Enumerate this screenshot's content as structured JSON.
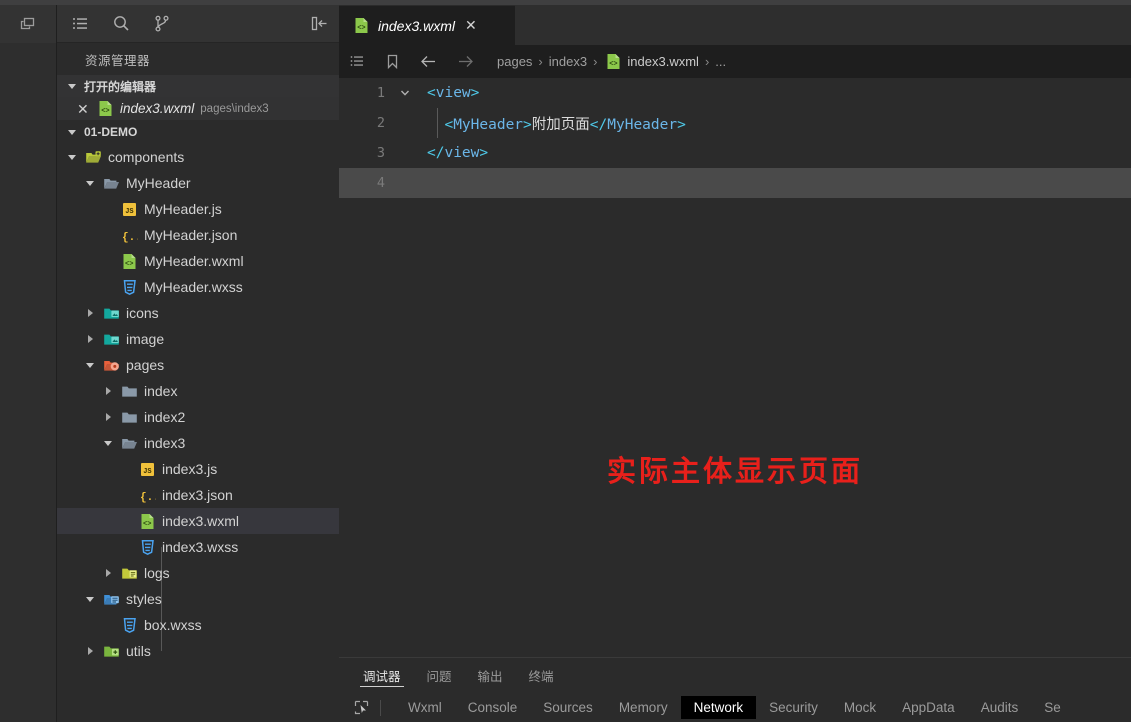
{
  "activitybar": {
    "top_icon": "window-restore-icon",
    "icons": [
      "explorer-list-icon",
      "search-icon",
      "source-control-icon"
    ],
    "collapse_icon": "collapse-sidebar-icon"
  },
  "sidebar": {
    "title": "资源管理器",
    "open_editors": {
      "label": "打开的编辑器",
      "items": [
        {
          "close": "✕",
          "icon": "wxml-file-icon",
          "name": "index3.wxml",
          "path": "pages\\index3"
        }
      ]
    },
    "project": {
      "label": "01-DEMO",
      "tree": [
        {
          "depth": 1,
          "twisty": "down",
          "icon": "folder-components-icon",
          "label": "components",
          "selected": false
        },
        {
          "depth": 2,
          "twisty": "down",
          "icon": "folder-open-icon",
          "label": "MyHeader",
          "selected": false
        },
        {
          "depth": 3,
          "twisty": "blank",
          "icon": "js-file-icon",
          "label": "MyHeader.js",
          "selected": false
        },
        {
          "depth": 3,
          "twisty": "blank",
          "icon": "json-file-icon",
          "label": "MyHeader.json",
          "selected": false
        },
        {
          "depth": 3,
          "twisty": "blank",
          "icon": "wxml-file-icon",
          "label": "MyHeader.wxml",
          "selected": false
        },
        {
          "depth": 3,
          "twisty": "blank",
          "icon": "wxss-file-icon",
          "label": "MyHeader.wxss",
          "selected": false
        },
        {
          "depth": 2,
          "twisty": "right",
          "icon": "folder-icons-icon",
          "label": "icons",
          "selected": false
        },
        {
          "depth": 2,
          "twisty": "right",
          "icon": "folder-image-icon",
          "label": "image",
          "selected": false
        },
        {
          "depth": 2,
          "twisty": "down",
          "icon": "folder-pages-icon",
          "label": "pages",
          "selected": false
        },
        {
          "depth": 3,
          "twisty": "right",
          "icon": "folder-closed-icon",
          "label": "index",
          "selected": false
        },
        {
          "depth": 3,
          "twisty": "right",
          "icon": "folder-closed-icon",
          "label": "index2",
          "selected": false
        },
        {
          "depth": 3,
          "twisty": "down",
          "icon": "folder-open-icon",
          "label": "index3",
          "selected": false
        },
        {
          "depth": 4,
          "twisty": "blank",
          "icon": "js-file-icon",
          "label": "index3.js",
          "selected": false
        },
        {
          "depth": 4,
          "twisty": "blank",
          "icon": "json-file-icon",
          "label": "index3.json",
          "selected": false
        },
        {
          "depth": 4,
          "twisty": "blank",
          "icon": "wxml-file-icon",
          "label": "index3.wxml",
          "selected": true
        },
        {
          "depth": 4,
          "twisty": "blank",
          "icon": "wxss-file-icon",
          "label": "index3.wxss",
          "selected": false
        },
        {
          "depth": 3,
          "twisty": "right",
          "icon": "folder-logs-icon",
          "label": "logs",
          "selected": false
        },
        {
          "depth": 2,
          "twisty": "down",
          "icon": "folder-styles-icon",
          "label": "styles",
          "selected": false
        },
        {
          "depth": 3,
          "twisty": "blank",
          "icon": "wxss-file-icon",
          "label": "box.wxss",
          "selected": false
        },
        {
          "depth": 2,
          "twisty": "right",
          "icon": "folder-utils-icon",
          "label": "utils",
          "selected": false
        }
      ]
    }
  },
  "editor": {
    "tab": {
      "icon": "wxml-file-icon",
      "name": "index3.wxml",
      "close": "✕"
    },
    "breadcrumb": {
      "icons": [
        "outline-list-icon",
        "bookmark-icon",
        "back-arrow-icon",
        "forward-arrow-icon"
      ],
      "items": [
        "pages",
        "index3",
        "index3.wxml",
        "..."
      ],
      "separator": "›",
      "file_icon": "wxml-file-icon"
    },
    "lines": [
      {
        "n": "1",
        "fold": "v",
        "indent_guide": false,
        "active": false,
        "tokens": [
          {
            "t": "<",
            "c": "br"
          },
          {
            "t": "view",
            "c": "tag"
          },
          {
            "t": ">",
            "c": "br"
          }
        ]
      },
      {
        "n": "2",
        "fold": "",
        "indent_guide": true,
        "active": false,
        "tokens": [
          {
            "t": "  <",
            "c": "br"
          },
          {
            "t": "MyHeader",
            "c": "tag"
          },
          {
            "t": ">",
            "c": "br"
          },
          {
            "t": "附加页面",
            "c": "txt"
          },
          {
            "t": "</",
            "c": "br"
          },
          {
            "t": "MyHeader",
            "c": "tag"
          },
          {
            "t": ">",
            "c": "br"
          }
        ]
      },
      {
        "n": "3",
        "fold": "",
        "indent_guide": false,
        "active": false,
        "tokens": [
          {
            "t": "</",
            "c": "br"
          },
          {
            "t": "view",
            "c": "tag"
          },
          {
            "t": ">",
            "c": "br"
          }
        ]
      },
      {
        "n": "4",
        "fold": "",
        "indent_guide": false,
        "active": true,
        "tokens": []
      }
    ],
    "preview_text": "实际主体显示页面"
  },
  "panel": {
    "tabs": [
      {
        "label": "调试器",
        "active": true
      },
      {
        "label": "问题",
        "active": false
      },
      {
        "label": "输出",
        "active": false
      },
      {
        "label": "终端",
        "active": false
      }
    ],
    "inspect_icon": "inspect-element-icon",
    "devtools_tabs": [
      {
        "label": "Wxml",
        "active": false
      },
      {
        "label": "Console",
        "active": false
      },
      {
        "label": "Sources",
        "active": false
      },
      {
        "label": "Memory",
        "active": false
      },
      {
        "label": "Network",
        "active": true
      },
      {
        "label": "Security",
        "active": false
      },
      {
        "label": "Mock",
        "active": false
      },
      {
        "label": "AppData",
        "active": false
      },
      {
        "label": "Audits",
        "active": false
      },
      {
        "label": "Se",
        "active": false
      }
    ]
  },
  "colors": {
    "accent_red": "#e8201b",
    "tag_blue": "#6bb6e8",
    "bracket_cyan": "#4ec9e8",
    "selection": "#37373d",
    "active_line": "#4a4a4a"
  }
}
